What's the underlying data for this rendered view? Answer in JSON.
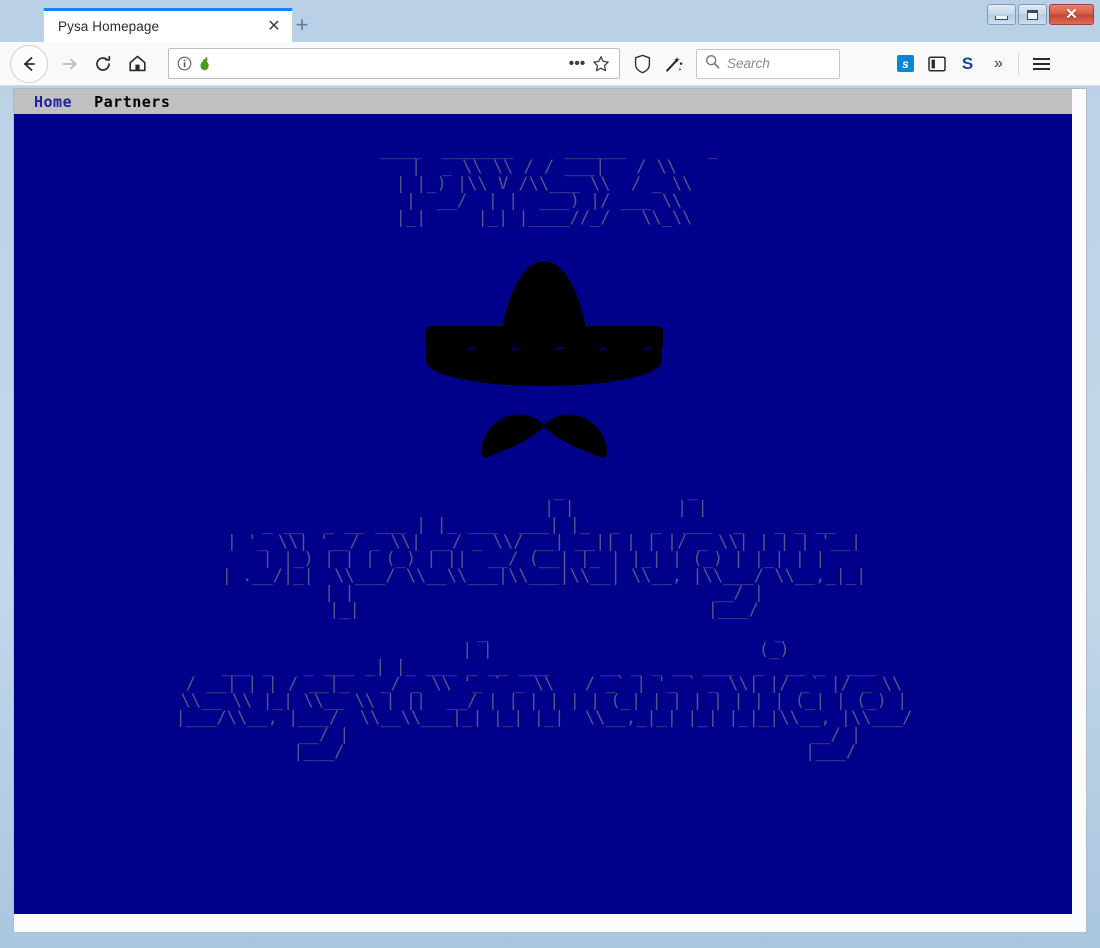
{
  "window": {
    "controls": {
      "minimize_label": "Minimize",
      "maximize_label": "Maximize",
      "close_label": "✕"
    }
  },
  "browser": {
    "tab": {
      "title": "Pysa Homepage",
      "close_label": "✕"
    },
    "new_tab_label": "+",
    "nav": {
      "back_label": "Back",
      "forward_label": "Forward",
      "reload_label": "Reload",
      "home_label": "Home"
    },
    "urlbar": {
      "value": "",
      "placeholder": "",
      "identity_icon": "info-icon",
      "favicon": "green-pear-icon",
      "page_actions_label": "•••",
      "bookmark_label": "Bookmark"
    },
    "tracking_protection_label": "Tracking Protection",
    "wand_icon_label": "pocket-icon",
    "search": {
      "placeholder": "Search",
      "value": "",
      "icon": "search-icon"
    },
    "extensions": [
      {
        "name": "extension-badge-s",
        "label": "s"
      },
      {
        "name": "sidebar-toggle-icon",
        "label": ""
      },
      {
        "name": "extension-letter-s",
        "label": "S"
      },
      {
        "name": "overflow-chevrons",
        "label": "»"
      }
    ],
    "menu_label": "Open menu"
  },
  "page": {
    "nav_links": [
      {
        "id": "home",
        "label": "Home",
        "color": "#2020a0"
      },
      {
        "id": "partners",
        "label": "Partners",
        "color": "#000000"
      }
    ],
    "background_color": "#00008b",
    "ascii_color": "#55558c",
    "title_ascii": " ____  _______     ______        _\n|  _ \\\\ \\\\ / / ___|   / \\\\\n| |_) |\\\\ V /\\\\___ \\\\  / _ \\\\\n|  __/  | |  ___) |/ ___ \\\\\n|_|     |_| |____//_/   \\\\_\\\\",
    "tagline_1_ascii": "                _            _\n                | |          | |\n _ __  _ __ ___ | |_ ___  ___| |_  _   _  ___  _   _ _ __\n| '_ \\\\| '__/ _ \\\\| __/ _ \\\\/ __| __|| | | |/ _ \\\\| | | | '__|\n| |_) | | | (_) | ||  __/ (__| |_ | |_| | (_) | |_| | |\n| .__/|_|  \\\\___/ \\\\__\\\\___|\\\\___|\\\\__| \\\\__, |\\\\___/ \\\\__,_|_|\n| |                                   __/ |\n|_|                                  |___/",
    "tagline_2_ascii": "                 _                            _\n                | |                          (_)\n ___ _   _ ___ _| |_ ___ _ __ ___     __ _ _ __ ___  _  __ _  ___\n/ __| | | / __|_   _/ _ \\\\ '_ ` _ \\\\   / _` | '_ ` _ \\\\| |/ _` |/ _ \\\\\n\\\\__ \\\\ |_| \\\\__ \\\\ | ||  __/ | | | | | | (_| | | | | | | | (_| | (_) |\n|___/\\\\__, |___/  \\\\__\\\\___|_| |_| |_|  \\\\__,_|_| |_| |_|_|\\\\__, |\\\\___/\n       __/ |                                             __/ |\n      |___/                                             |___/",
    "mascot": {
      "name": "sombrero-and-mustache-logo",
      "color": "#000000"
    }
  }
}
